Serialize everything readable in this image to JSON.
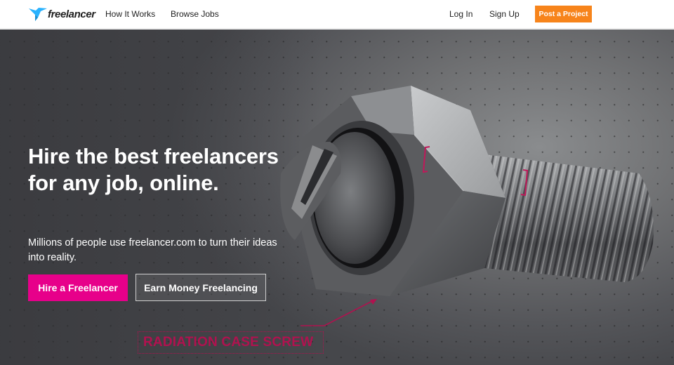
{
  "header": {
    "logo_text": "freelancer",
    "nav_left": [
      "How It Works",
      "Browse Jobs"
    ],
    "login_label": "Log In",
    "signup_label": "Sign Up",
    "post_project_label": "Post a Project"
  },
  "hero": {
    "headline": "Hire the best freelancers for any job, online.",
    "subtext": "Millions of people use freelancer.com to turn their ideas into reality.",
    "hire_button_label": "Hire a Freelancer",
    "earn_button_label": "Earn Money Freelancing",
    "annotation_label": "RADIATION CASE SCREW"
  },
  "colors": {
    "brand_blue": "#29b2fe",
    "post_project_orange": "#f7841b",
    "hire_pink": "#e7008a",
    "annotation_red": "#b0124f"
  }
}
